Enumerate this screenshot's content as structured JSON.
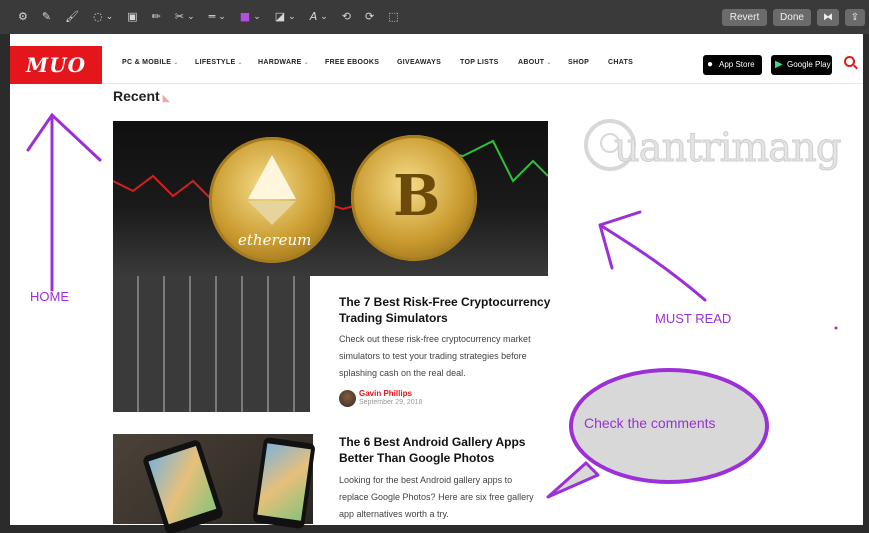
{
  "toolbar": {
    "tools": [
      "⚙",
      "✎",
      "🖌",
      "◌",
      "▣",
      "✏",
      "✂",
      "═",
      "■",
      "◪",
      "A",
      "⟲",
      "⟳",
      "⬚"
    ],
    "revert_label": "Revert",
    "done_label": "Done",
    "rotate_label": "⧓",
    "share_label": "⇪"
  },
  "site": {
    "logo_text": "MUO",
    "nav_items": [
      {
        "label": "PC & MOBILE",
        "dropdown": true
      },
      {
        "label": "LIFESTYLE",
        "dropdown": true
      },
      {
        "label": "HARDWARE",
        "dropdown": true
      },
      {
        "label": "FREE EBOOKS",
        "dropdown": false
      },
      {
        "label": "GIVEAWAYS",
        "dropdown": false
      },
      {
        "label": "TOP LISTS",
        "dropdown": false
      },
      {
        "label": "ABOUT",
        "dropdown": true
      },
      {
        "label": "SHOP",
        "dropdown": false
      },
      {
        "label": "CHATS",
        "dropdown": false
      }
    ],
    "app_store_label": "App Store",
    "google_play_label": "Google Play",
    "accent_color": "#e4161b"
  },
  "main": {
    "section_title": "Recent",
    "hero": {
      "coin_label": "ethereum"
    },
    "articles": [
      {
        "title_line1": "The 7 Best Risk-Free Cryptocurrency",
        "title_line2": "Trading Simulators",
        "excerpt_line1": "Check out these risk-free cryptocurrency market",
        "excerpt_line2": "simulators to test your trading strategies before",
        "excerpt_line3": "splashing cash on the real deal.",
        "author": "Gavin Phillips",
        "date": "September 29, 2018"
      },
      {
        "title_line1": "The 6 Best Android Gallery Apps",
        "title_line2": "Better Than Google Photos",
        "excerpt_line1": "Looking for the best Android gallery apps to",
        "excerpt_line2": "replace Google Photos? Here are six free gallery",
        "excerpt_line3": "app alternatives worth a try."
      }
    ]
  },
  "annotations": {
    "home": "HOME",
    "must_read": "MUST READ",
    "comments": "Check the comments",
    "color": "#9b30d9"
  },
  "watermark": {
    "text": "uantrimang"
  }
}
